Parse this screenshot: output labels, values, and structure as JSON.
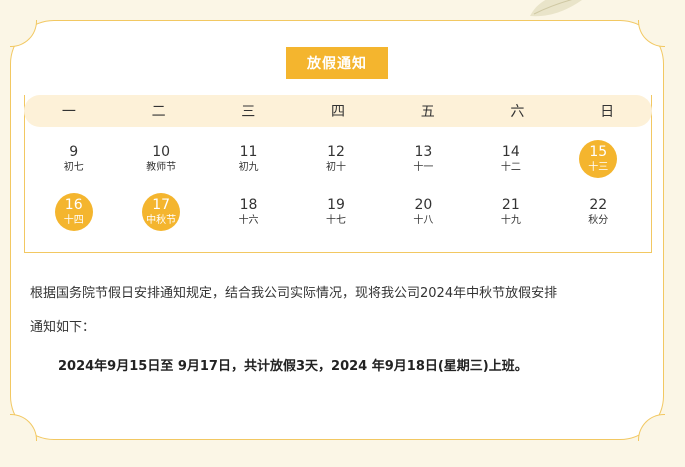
{
  "title": "放假通知",
  "weekdays": [
    "一",
    "二",
    "三",
    "四",
    "五",
    "六",
    "日"
  ],
  "weeks": [
    [
      {
        "num": "9",
        "lunar": "初七",
        "holiday": false
      },
      {
        "num": "10",
        "lunar": "教师节",
        "holiday": false
      },
      {
        "num": "11",
        "lunar": "初九",
        "holiday": false
      },
      {
        "num": "12",
        "lunar": "初十",
        "holiday": false
      },
      {
        "num": "13",
        "lunar": "十一",
        "holiday": false
      },
      {
        "num": "14",
        "lunar": "十二",
        "holiday": false
      },
      {
        "num": "15",
        "lunar": "十三",
        "holiday": true
      }
    ],
    [
      {
        "num": "16",
        "lunar": "十四",
        "holiday": true
      },
      {
        "num": "17",
        "lunar": "中秋节",
        "holiday": true
      },
      {
        "num": "18",
        "lunar": "十六",
        "holiday": false
      },
      {
        "num": "19",
        "lunar": "十七",
        "holiday": false
      },
      {
        "num": "20",
        "lunar": "十八",
        "holiday": false
      },
      {
        "num": "21",
        "lunar": "十九",
        "holiday": false
      },
      {
        "num": "22",
        "lunar": "秋分",
        "holiday": false
      }
    ]
  ],
  "body": {
    "line1": "根据国务院节假日安排通知规定，结合我公司实际情况，现将我公司2024年中秋节放假安排",
    "line2": "通知如下：",
    "summary": "2024年9月15日至 9月17日，共计放假3天，2024 年9月18日(星期三)上班。"
  },
  "colors": {
    "accent": "#f4b52e",
    "border": "#f2c862",
    "weekday_bg": "#fdf1d8",
    "page_bg": "#fbf6e6"
  }
}
